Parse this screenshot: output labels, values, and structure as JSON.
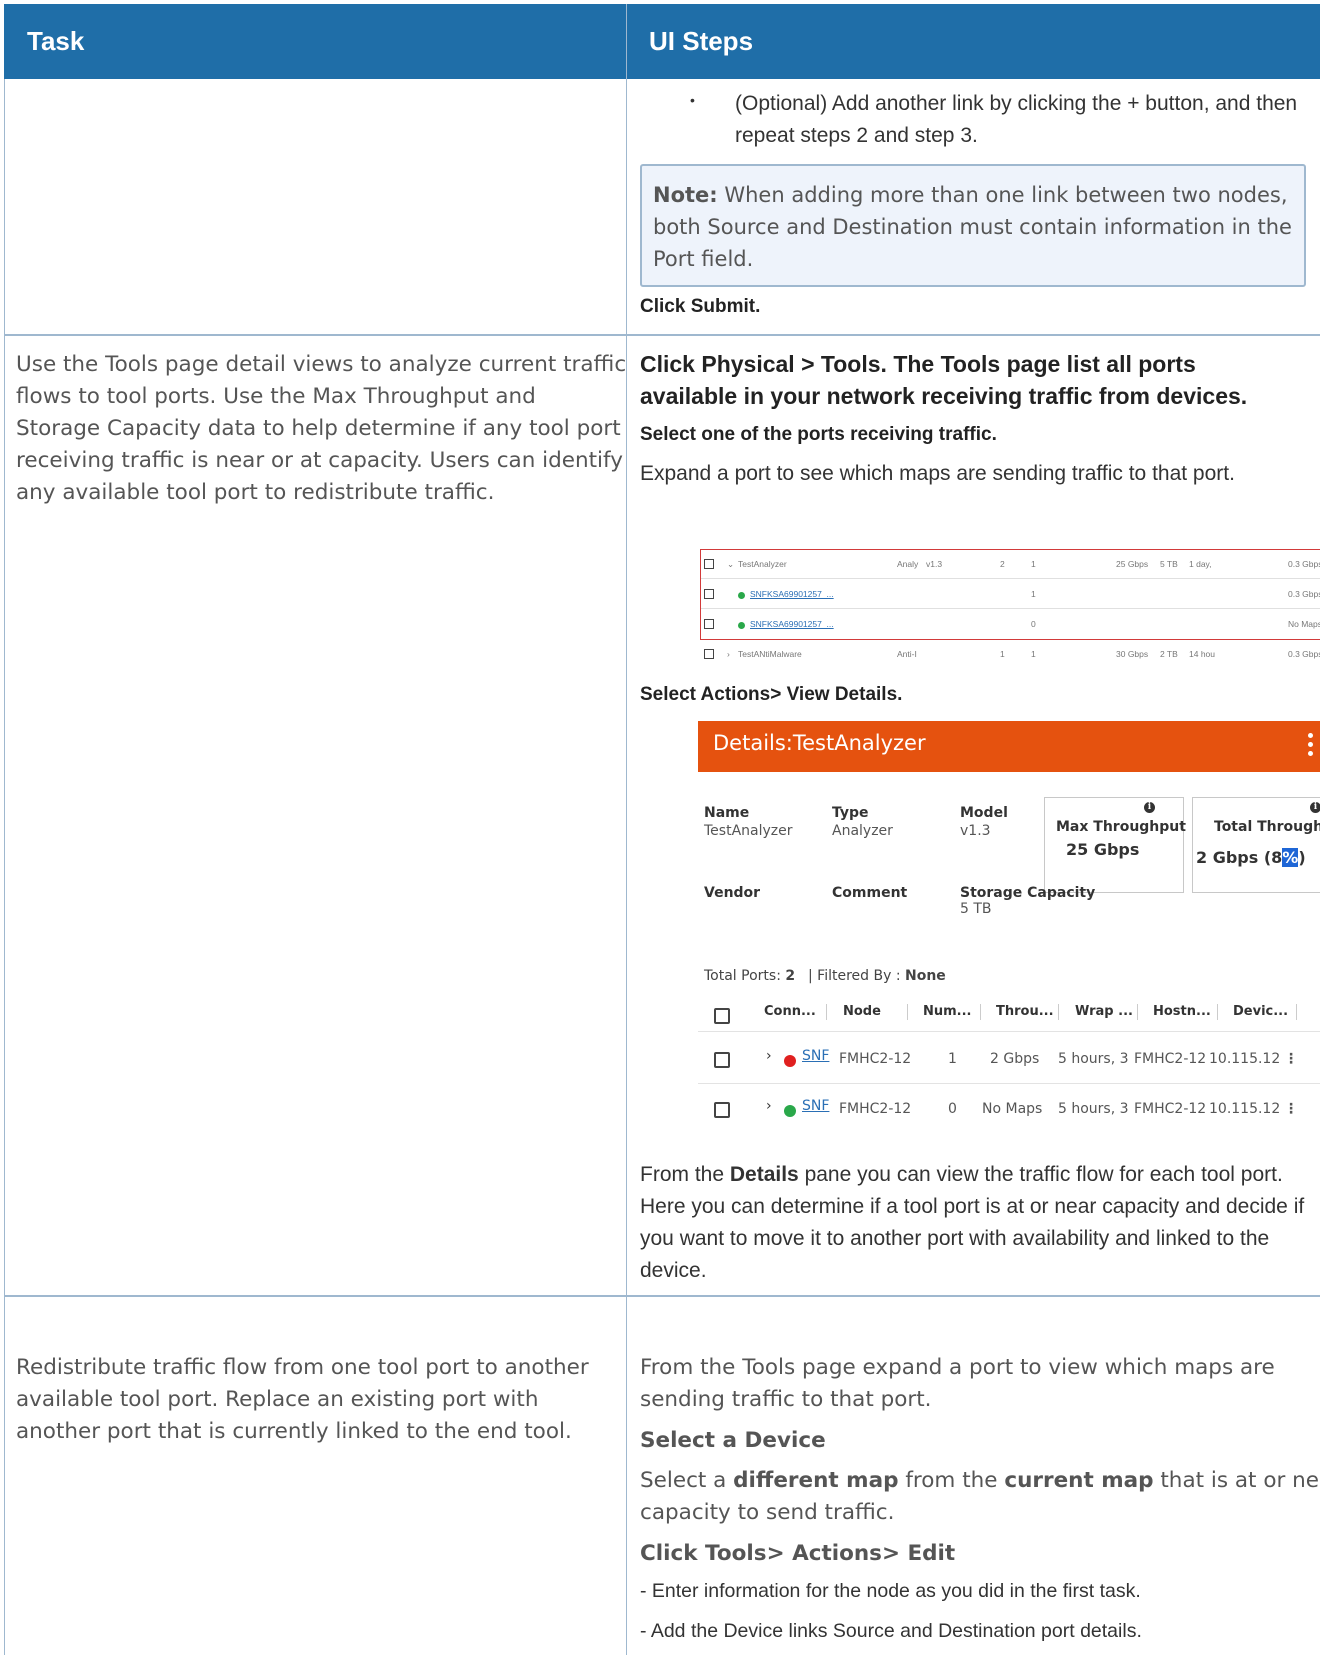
{
  "header": {
    "task": "Task",
    "ui_steps": "UI Steps"
  },
  "row1": {
    "bullet": "•",
    "optional_line1": "(Optional) Add another link by clicking the + button, and then",
    "optional_line2": "repeat steps 2 and step 3.",
    "note_label": "Note:",
    "note_text": " When adding more than one link between two nodes, both Source and Destination must contain information in the Port field.",
    "click_submit": "Click Submit."
  },
  "row2": {
    "task_lines": [
      "Use the Tools page detail views to analyze current traffic",
      "flows to tool ports. Use the Max Throughput and",
      "Storage Capacity data to help determine if any tool port",
      "receiving traffic is near or at capacity. Users can identify",
      "any available tool port to redistribute traffic."
    ],
    "step1_line1": "Click Physical > Tools. The Tools page list all ports",
    "step1_line2": "available in your network receiving traffic from devices.",
    "step2": "Select one of the ports receiving traffic.",
    "step3": "Expand a port to see which maps are sending traffic to that port.",
    "tools_rows": [
      {
        "name": "TestAnalyzer",
        "type": "Analy",
        "ver": "v1.3",
        "n1": "2",
        "n2": "1",
        "thru": "25 Gbps",
        "stor": "5 TB",
        "up": "1 day,",
        "rate": "0.3 Gbps"
      },
      {
        "name": "SNFKSA69901257_...",
        "n2": "1",
        "rate": "0.3 Gbps"
      },
      {
        "name": "SNFKSA69901257_...",
        "n2": "0",
        "rate": "No Maps"
      },
      {
        "name": "TestANtiMalware",
        "type": "Anti-I",
        "n1": "1",
        "n2": "1",
        "thru": "30 Gbps",
        "stor": "2 TB",
        "up": "14 hou",
        "rate": "0.3 Gbps"
      }
    ],
    "step4": "Select Actions> View Details.",
    "details": {
      "title": "Details:TestAnalyzer",
      "name_label": "Name",
      "name_value": "TestAnalyzer",
      "type_label": "Type",
      "type_value": "Analyzer",
      "model_label": "Model",
      "model_value": "v1.3",
      "max_label": "Max Throughput",
      "max_value": "25 Gbps",
      "total_label": "Total Throughput",
      "total_value_a": "2 Gbps (8",
      "total_value_b": "%",
      "total_value_c": ")",
      "vendor_label": "Vendor",
      "comment_label": "Comment",
      "storage_label": "Storage Capacity",
      "storage_value": "5 TB",
      "total_ports_label": "Total Ports:",
      "total_ports_value": "2",
      "filtered_label": "| Filtered By :",
      "filtered_value": "None",
      "columns": [
        "Conn...",
        "Node",
        "Num...",
        "Throu...",
        "Wrap ...",
        "Hostn...",
        "Devic..."
      ],
      "rows": [
        {
          "conn": "SNF",
          "node": "FMHC2-12",
          "num": "1",
          "thru": "2 Gbps",
          "wrap": "5 hours, 3",
          "host": "FMHC2-12",
          "dev": "10.115.12",
          "status_color": "#e0201f"
        },
        {
          "conn": "SNF",
          "node": "FMHC2-12",
          "num": "0",
          "thru": "No Maps",
          "wrap": "5 hours, 3",
          "host": "FMHC2-12",
          "dev": "10.115.12",
          "status_color": "#2aa84a"
        }
      ]
    },
    "para_a": "From the ",
    "para_bold": "Details",
    "para_b": " pane you can view the traffic flow for each tool port.",
    "para_line2": "Here you can determine if a tool port is at or near capacity and decide if",
    "para_line3": "you want to move it to another port with availability and linked to the",
    "para_line4": "device."
  },
  "row3": {
    "task_lines": [
      "Redistribute traffic flow from one tool port to another",
      "available tool port. Replace an existing port with",
      "another port that is currently linked to the end tool."
    ],
    "step1_line1": "From the Tools page expand a port to view which maps are",
    "step1_line2": "sending traffic to that port.",
    "select_device": "Select a Device",
    "sel_a": "Select a ",
    "sel_bold1": "different map",
    "sel_b": " from the ",
    "sel_bold2": "current map",
    "sel_c": " that is at or near",
    "sel_line2": "capacity to send traffic.",
    "click_tools": "Click Tools> Actions> Edit",
    "enter_info": "- Enter information for the node as you did in the first task.",
    "add_links": "- Add the Device links Source and Destination port details."
  }
}
